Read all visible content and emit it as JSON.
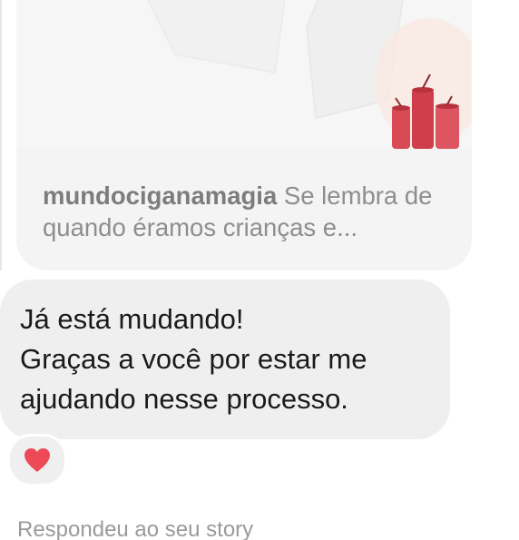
{
  "shared_post": {
    "username": "mundociganamagia",
    "caption": "Se lembra de quando éramos crianças e..."
  },
  "message": {
    "lines": [
      "Já está mudando!",
      "Graças a você por estar me",
      "ajudando nesse processo."
    ]
  },
  "reaction": {
    "icon": "heart-icon",
    "color": "#ed4956"
  },
  "status": {
    "text": "Respondeu ao seu story"
  }
}
